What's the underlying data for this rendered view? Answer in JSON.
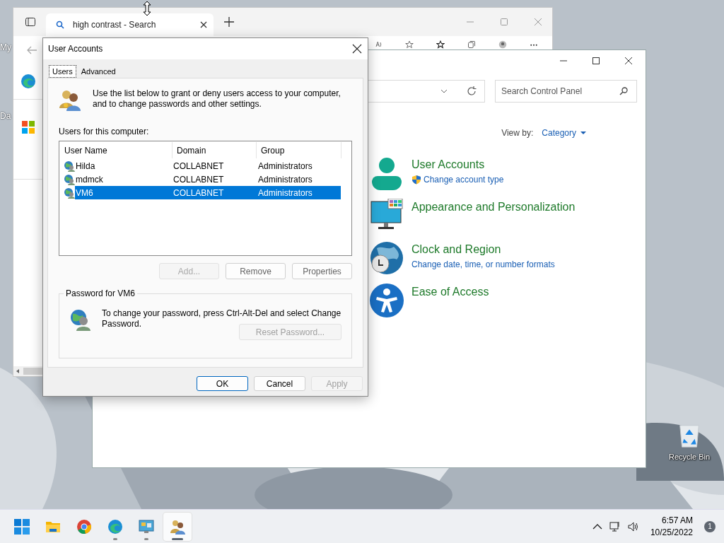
{
  "desktop": {
    "icons": [
      {
        "label": "My"
      },
      {
        "label": "Da"
      },
      {
        "label": "Recycle Bin"
      }
    ]
  },
  "browser": {
    "tabs": [
      {
        "label": "high contrast - Search",
        "selected": true
      }
    ]
  },
  "control_panel": {
    "search": {
      "placeholder": "Search Control Panel"
    },
    "view_by": {
      "label": "View by:",
      "value": "Category"
    },
    "categories": [
      {
        "title": "User Accounts",
        "links": [
          {
            "text": "Change account type",
            "kind": "admin"
          }
        ]
      },
      {
        "title": "Appearance and Personalization"
      },
      {
        "title": "Clock and Region",
        "links": [
          {
            "text": "Change date, time, or number formats",
            "kind": "plain"
          }
        ]
      },
      {
        "title": "Ease of Access"
      }
    ]
  },
  "dialog": {
    "title": "User Accounts",
    "tabs": [
      {
        "label": "Users",
        "selected": true
      },
      {
        "label": "Advanced",
        "selected": false
      }
    ],
    "intro": "Use the list below to grant or deny users access to your computer, and to change passwords and other settings.",
    "list_label": "Users for this computer:",
    "columns": [
      "User Name",
      "Domain",
      "Group"
    ],
    "rows": [
      {
        "cells": [
          "Hilda",
          "COLLABNET",
          "Administrators"
        ],
        "selected": false
      },
      {
        "cells": [
          "mdmck",
          "COLLABNET",
          "Administrators"
        ],
        "selected": false
      },
      {
        "cells": [
          "VM6",
          "COLLABNET",
          "Administrators"
        ],
        "selected": true
      }
    ],
    "list_buttons": [
      {
        "label": "Add...",
        "disabled": true
      },
      {
        "label": "Remove",
        "disabled": false
      },
      {
        "label": "Properties",
        "disabled": false
      }
    ],
    "password": {
      "title": "Password for VM6",
      "text": "To change your password, press Ctrl-Alt-Del and select Change Password.",
      "button": {
        "label": "Reset Password...",
        "disabled": true
      }
    },
    "buttons": [
      {
        "label": "OK",
        "disabled": false,
        "default": true
      },
      {
        "label": "Cancel",
        "disabled": false,
        "default": false
      },
      {
        "label": "Apply",
        "disabled": true,
        "default": false
      }
    ]
  },
  "taskbar": {
    "apps": [
      {
        "selected": false,
        "running": false
      },
      {
        "selected": false,
        "running": false
      },
      {
        "selected": false,
        "running": false
      },
      {
        "selected": false,
        "running": true
      },
      {
        "selected": false,
        "running": true
      },
      {
        "selected": true,
        "running": true
      }
    ],
    "time": "6:57 AM",
    "date": "10/25/2022",
    "notifications": "1"
  }
}
